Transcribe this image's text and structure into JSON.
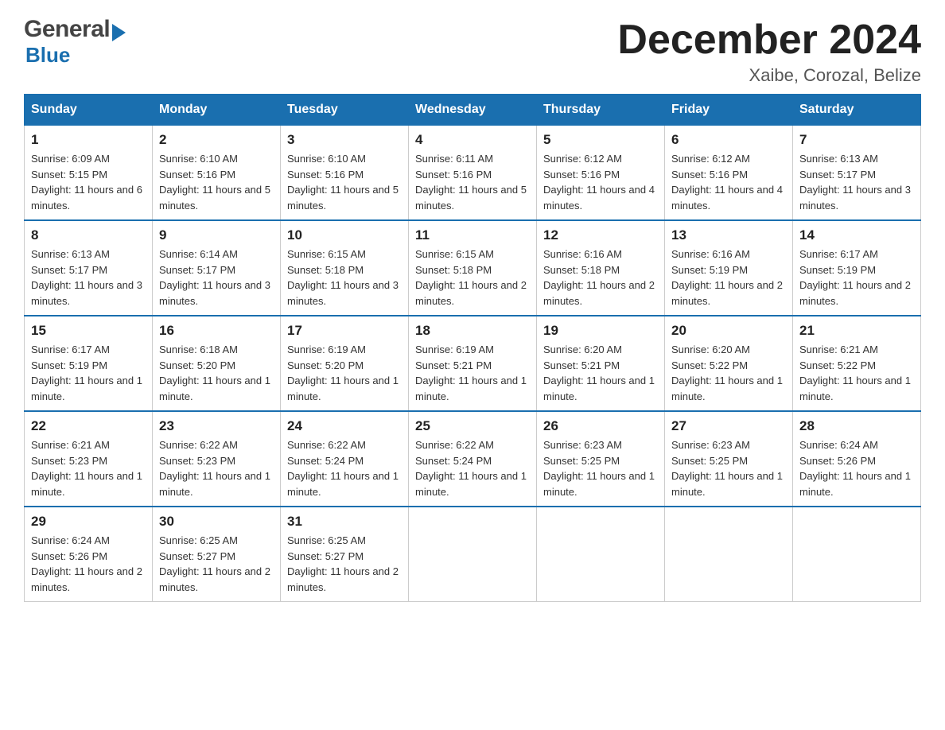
{
  "header": {
    "logo_general": "General",
    "logo_blue": "Blue",
    "month_title": "December 2024",
    "location": "Xaibe, Corozal, Belize"
  },
  "weekdays": [
    "Sunday",
    "Monday",
    "Tuesday",
    "Wednesday",
    "Thursday",
    "Friday",
    "Saturday"
  ],
  "weeks": [
    [
      {
        "day": "1",
        "sunrise": "6:09 AM",
        "sunset": "5:15 PM",
        "daylight": "11 hours and 6 minutes."
      },
      {
        "day": "2",
        "sunrise": "6:10 AM",
        "sunset": "5:16 PM",
        "daylight": "11 hours and 5 minutes."
      },
      {
        "day": "3",
        "sunrise": "6:10 AM",
        "sunset": "5:16 PM",
        "daylight": "11 hours and 5 minutes."
      },
      {
        "day": "4",
        "sunrise": "6:11 AM",
        "sunset": "5:16 PM",
        "daylight": "11 hours and 5 minutes."
      },
      {
        "day": "5",
        "sunrise": "6:12 AM",
        "sunset": "5:16 PM",
        "daylight": "11 hours and 4 minutes."
      },
      {
        "day": "6",
        "sunrise": "6:12 AM",
        "sunset": "5:16 PM",
        "daylight": "11 hours and 4 minutes."
      },
      {
        "day": "7",
        "sunrise": "6:13 AM",
        "sunset": "5:17 PM",
        "daylight": "11 hours and 3 minutes."
      }
    ],
    [
      {
        "day": "8",
        "sunrise": "6:13 AM",
        "sunset": "5:17 PM",
        "daylight": "11 hours and 3 minutes."
      },
      {
        "day": "9",
        "sunrise": "6:14 AM",
        "sunset": "5:17 PM",
        "daylight": "11 hours and 3 minutes."
      },
      {
        "day": "10",
        "sunrise": "6:15 AM",
        "sunset": "5:18 PM",
        "daylight": "11 hours and 3 minutes."
      },
      {
        "day": "11",
        "sunrise": "6:15 AM",
        "sunset": "5:18 PM",
        "daylight": "11 hours and 2 minutes."
      },
      {
        "day": "12",
        "sunrise": "6:16 AM",
        "sunset": "5:18 PM",
        "daylight": "11 hours and 2 minutes."
      },
      {
        "day": "13",
        "sunrise": "6:16 AM",
        "sunset": "5:19 PM",
        "daylight": "11 hours and 2 minutes."
      },
      {
        "day": "14",
        "sunrise": "6:17 AM",
        "sunset": "5:19 PM",
        "daylight": "11 hours and 2 minutes."
      }
    ],
    [
      {
        "day": "15",
        "sunrise": "6:17 AM",
        "sunset": "5:19 PM",
        "daylight": "11 hours and 1 minute."
      },
      {
        "day": "16",
        "sunrise": "6:18 AM",
        "sunset": "5:20 PM",
        "daylight": "11 hours and 1 minute."
      },
      {
        "day": "17",
        "sunrise": "6:19 AM",
        "sunset": "5:20 PM",
        "daylight": "11 hours and 1 minute."
      },
      {
        "day": "18",
        "sunrise": "6:19 AM",
        "sunset": "5:21 PM",
        "daylight": "11 hours and 1 minute."
      },
      {
        "day": "19",
        "sunrise": "6:20 AM",
        "sunset": "5:21 PM",
        "daylight": "11 hours and 1 minute."
      },
      {
        "day": "20",
        "sunrise": "6:20 AM",
        "sunset": "5:22 PM",
        "daylight": "11 hours and 1 minute."
      },
      {
        "day": "21",
        "sunrise": "6:21 AM",
        "sunset": "5:22 PM",
        "daylight": "11 hours and 1 minute."
      }
    ],
    [
      {
        "day": "22",
        "sunrise": "6:21 AM",
        "sunset": "5:23 PM",
        "daylight": "11 hours and 1 minute."
      },
      {
        "day": "23",
        "sunrise": "6:22 AM",
        "sunset": "5:23 PM",
        "daylight": "11 hours and 1 minute."
      },
      {
        "day": "24",
        "sunrise": "6:22 AM",
        "sunset": "5:24 PM",
        "daylight": "11 hours and 1 minute."
      },
      {
        "day": "25",
        "sunrise": "6:22 AM",
        "sunset": "5:24 PM",
        "daylight": "11 hours and 1 minute."
      },
      {
        "day": "26",
        "sunrise": "6:23 AM",
        "sunset": "5:25 PM",
        "daylight": "11 hours and 1 minute."
      },
      {
        "day": "27",
        "sunrise": "6:23 AM",
        "sunset": "5:25 PM",
        "daylight": "11 hours and 1 minute."
      },
      {
        "day": "28",
        "sunrise": "6:24 AM",
        "sunset": "5:26 PM",
        "daylight": "11 hours and 1 minute."
      }
    ],
    [
      {
        "day": "29",
        "sunrise": "6:24 AM",
        "sunset": "5:26 PM",
        "daylight": "11 hours and 2 minutes."
      },
      {
        "day": "30",
        "sunrise": "6:25 AM",
        "sunset": "5:27 PM",
        "daylight": "11 hours and 2 minutes."
      },
      {
        "day": "31",
        "sunrise": "6:25 AM",
        "sunset": "5:27 PM",
        "daylight": "11 hours and 2 minutes."
      },
      null,
      null,
      null,
      null
    ]
  ],
  "sunrise_label": "Sunrise:",
  "sunset_label": "Sunset:",
  "daylight_label": "Daylight:"
}
